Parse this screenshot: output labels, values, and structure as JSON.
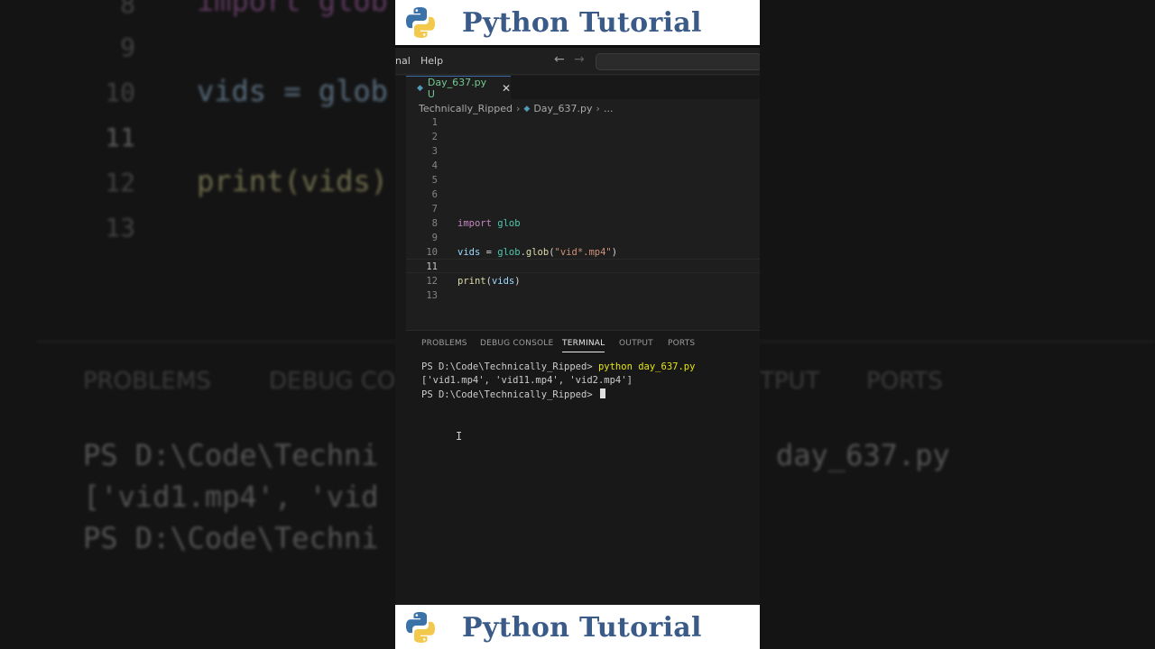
{
  "banner": {
    "title": "Python Tutorial"
  },
  "menubar": {
    "partial_item": "nal",
    "help": "Help",
    "back_icon": "arrow-left-icon",
    "forward_icon": "arrow-right-icon"
  },
  "editor_tab": {
    "filename": "Day_637.py",
    "status": "U",
    "close_icon": "close-icon"
  },
  "breadcrumb": {
    "folder": "Technically_Ripped",
    "file": "Day_637.py",
    "more": "..."
  },
  "code_lines": [
    {
      "n": "1",
      "text": ""
    },
    {
      "n": "2",
      "text": ""
    },
    {
      "n": "3",
      "text": ""
    },
    {
      "n": "4",
      "text": ""
    },
    {
      "n": "5",
      "text": ""
    },
    {
      "n": "6",
      "text": ""
    },
    {
      "n": "7",
      "text": ""
    },
    {
      "n": "8",
      "text": "import glob"
    },
    {
      "n": "9",
      "text": ""
    },
    {
      "n": "10",
      "text": "vids = glob.glob(\"vid*.mp4\")"
    },
    {
      "n": "11",
      "text": ""
    },
    {
      "n": "12",
      "text": "print(vids)"
    },
    {
      "n": "13",
      "text": ""
    }
  ],
  "panel_tabs": [
    "PROBLEMS",
    "DEBUG CONSOLE",
    "TERMINAL",
    "OUTPUT",
    "PORTS"
  ],
  "active_panel_tab": "TERMINAL",
  "terminal": {
    "prompt1": "PS D:\\Code\\Technically_Ripped> ",
    "command": "python day_637.py",
    "output": "['vid1.mp4', 'vid11.mp4', 'vid2.mp4']",
    "prompt2": "PS D:\\Code\\Technically_Ripped> "
  },
  "background": {
    "line_numbers": [
      "8",
      "9",
      "10",
      "11",
      "12",
      "13"
    ],
    "code_import": "import glob",
    "code_vids": "vids = glob",
    "code_print": "print(vids)",
    "tabs": [
      "PROBLEMS",
      "DEBUG CO",
      "TPUT",
      "PORTS"
    ],
    "term_line1": "PS D:\\Code\\Techni",
    "term_line1_right": "day_637.py",
    "term_line2": "['vid1.mp4', 'vid",
    "term_line3": "PS D:\\Code\\Techni"
  },
  "colors": {
    "accent": "#3b6ea8",
    "banner_text": "#3a5a88",
    "modified": "#73c991"
  }
}
